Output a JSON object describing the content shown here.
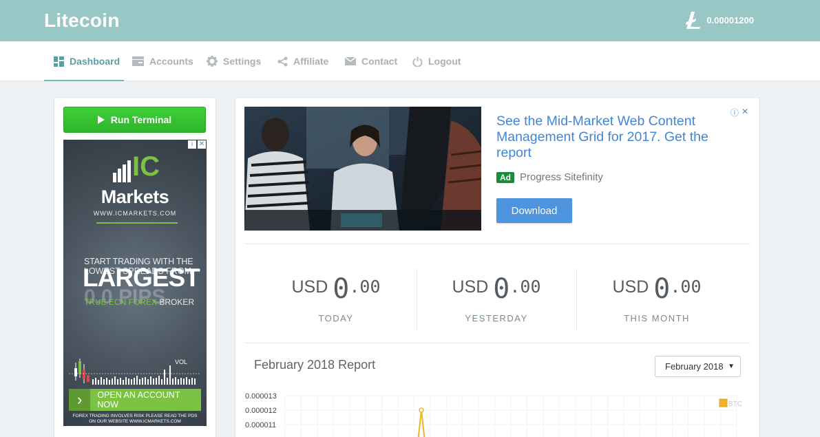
{
  "header": {
    "brand": "Litecoin",
    "balance": "0.00001200"
  },
  "nav": {
    "items": [
      {
        "label": "Dashboard",
        "icon": "dashboard-icon",
        "active": true
      },
      {
        "label": "Accounts",
        "icon": "accounts-icon"
      },
      {
        "label": "Settings",
        "icon": "gear-icon"
      },
      {
        "label": "Affiliate",
        "icon": "share-icon"
      },
      {
        "label": "Contact",
        "icon": "envelope-icon"
      },
      {
        "label": "Logout",
        "icon": "power-icon"
      }
    ]
  },
  "sidebar": {
    "run_terminal": "Run Terminal",
    "banner_ad": {
      "logo_text": "IC",
      "brand": "Markets",
      "url": "WWW.ICMARKETS.COM",
      "tag1": "START TRADING WITH THE",
      "tag2": "LOWEST SPREADS FROM",
      "headline": "LARGEST",
      "pips": "0.0 PIPS",
      "tag3_green": "TRUE ECN FOREX",
      "tag3_white": " BROKER",
      "vol": "VOL",
      "cta": "OPEN AN ACCOUNT NOW",
      "disclaimer_1": "FOREX TRADING INVOLVES RISK PLEASE READ THE PDS",
      "disclaimer_2": "ON OUR WEBSITE WWW.ICMARKETS.COM"
    }
  },
  "main": {
    "ad": {
      "title": "See the Mid-Market Web Content Management Grid for 2017. Get the report",
      "badge": "Ad",
      "sponsor": "Progress Sitefinity",
      "button": "Download"
    },
    "stats": [
      {
        "currency": "USD",
        "whole": "0",
        "decimal": ".00",
        "label": "TODAY"
      },
      {
        "currency": "USD",
        "whole": "0",
        "decimal": ".00",
        "label": "YESTERDAY"
      },
      {
        "currency": "USD",
        "whole": "0",
        "decimal": ".00",
        "label": "THIS MONTH"
      }
    ],
    "report": {
      "title": "February 2018 Report",
      "selected_month": "February 2018"
    }
  },
  "colors": {
    "header": "#99c7c5",
    "nav_active": "#5a9fa3",
    "run_button": "#34c12f",
    "ad_link": "#4285d6",
    "series": "#f0b429"
  },
  "chart_data": {
    "type": "line",
    "ytick_labels": [
      "0.000013",
      "0.000012",
      "0.000011"
    ],
    "legend": [
      "BTC"
    ],
    "series": [
      {
        "name": "BTC",
        "values": [
          1.2e-05
        ]
      }
    ]
  }
}
